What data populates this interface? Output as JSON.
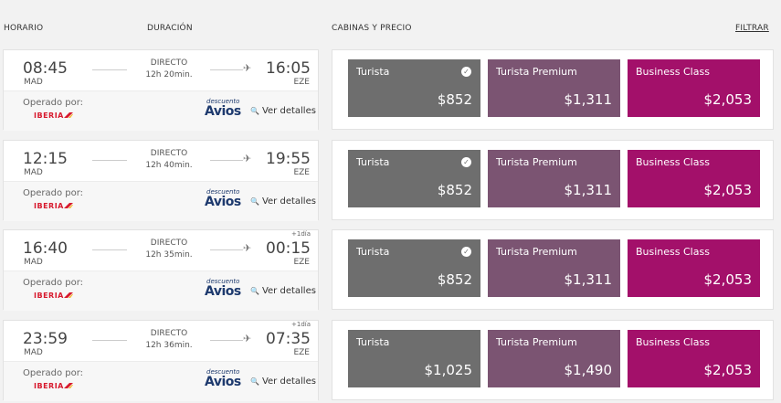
{
  "header": {
    "horario": "HORARIO",
    "duracion": "DURACIÓN",
    "cabinas": "CABINAS Y PRECIO",
    "filtrar": "FILTRAR"
  },
  "colors": {
    "turista": "#6e6e6e",
    "premium": "#7b5472",
    "business": "#a3106a"
  },
  "flights": [
    {
      "dep_time": "08:45",
      "dep_code": "MAD",
      "arr_time": "16:05",
      "arr_code": "EZE",
      "plus_day": "",
      "direct": "DIRECTO",
      "duration": "12h 20min.",
      "operated_by": "Operado por:",
      "airline": "IBERIA",
      "discount": "descuento",
      "avios": "Avios",
      "details": "Ver detalles",
      "fares": [
        {
          "name": "Turista",
          "price": "$852",
          "badge": "check-badge-icon"
        },
        {
          "name": "Turista Premium",
          "price": "$1,311"
        },
        {
          "name": "Business Class",
          "price": "$2,053"
        }
      ]
    },
    {
      "dep_time": "12:15",
      "dep_code": "MAD",
      "arr_time": "19:55",
      "arr_code": "EZE",
      "plus_day": "",
      "direct": "DIRECTO",
      "duration": "12h 40min.",
      "operated_by": "Operado por:",
      "airline": "IBERIA",
      "discount": "descuento",
      "avios": "Avios",
      "details": "Ver detalles",
      "fares": [
        {
          "name": "Turista",
          "price": "$852",
          "badge": "check-badge-icon"
        },
        {
          "name": "Turista Premium",
          "price": "$1,311"
        },
        {
          "name": "Business Class",
          "price": "$2,053"
        }
      ]
    },
    {
      "dep_time": "16:40",
      "dep_code": "MAD",
      "arr_time": "00:15",
      "arr_code": "EZE",
      "plus_day": "+1día",
      "direct": "DIRECTO",
      "duration": "12h 35min.",
      "operated_by": "Operado por:",
      "airline": "IBERIA",
      "discount": "descuento",
      "avios": "Avios",
      "details": "Ver detalles",
      "fares": [
        {
          "name": "Turista",
          "price": "$852",
          "badge": "check-badge-icon"
        },
        {
          "name": "Turista Premium",
          "price": "$1,311"
        },
        {
          "name": "Business Class",
          "price": "$2,053"
        }
      ]
    },
    {
      "dep_time": "23:59",
      "dep_code": "MAD",
      "arr_time": "07:35",
      "arr_code": "EZE",
      "plus_day": "+1día",
      "direct": "DIRECTO",
      "duration": "12h 36min.",
      "operated_by": "Operado por:",
      "airline": "IBERIA",
      "discount": "descuento",
      "avios": "Avios",
      "details": "Ver detalles",
      "fares": [
        {
          "name": "Turista",
          "price": "$1,025"
        },
        {
          "name": "Turista Premium",
          "price": "$1,490"
        },
        {
          "name": "Business Class",
          "price": "$2,053"
        }
      ]
    }
  ]
}
